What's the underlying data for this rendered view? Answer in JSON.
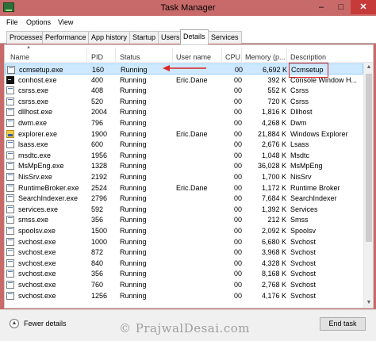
{
  "window": {
    "title": "Task Manager",
    "minimize_glyph": "–",
    "maximize_glyph": "□",
    "close_glyph": "✕"
  },
  "menu": [
    {
      "label": "File"
    },
    {
      "label": "Options"
    },
    {
      "label": "View"
    }
  ],
  "tabs": [
    {
      "label": "Processes"
    },
    {
      "label": "Performance"
    },
    {
      "label": "App history"
    },
    {
      "label": "Startup"
    },
    {
      "label": "Users"
    },
    {
      "label": "Details"
    },
    {
      "label": "Services"
    }
  ],
  "active_tab": "Details",
  "columns": {
    "name": "Name",
    "pid": "PID",
    "status": "Status",
    "user": "User name",
    "cpu": "CPU",
    "memory": "Memory (p...",
    "description": "Description"
  },
  "rows": [
    {
      "icon": "window-icon",
      "name": "ccmsetup.exe",
      "pid": "160",
      "status": "Running",
      "user": "",
      "cpu": "00",
      "memory": "6,692 K",
      "description": "Ccmsetup"
    },
    {
      "icon": "console-icon",
      "name": "conhost.exe",
      "pid": "400",
      "status": "Running",
      "user": "Eric.Dane",
      "cpu": "00",
      "memory": "392 K",
      "description": "Console Window H..."
    },
    {
      "icon": "window-icon",
      "name": "csrss.exe",
      "pid": "408",
      "status": "Running",
      "user": "",
      "cpu": "00",
      "memory": "552 K",
      "description": "Csrss"
    },
    {
      "icon": "window-icon",
      "name": "csrss.exe",
      "pid": "520",
      "status": "Running",
      "user": "",
      "cpu": "00",
      "memory": "720 K",
      "description": "Csrss"
    },
    {
      "icon": "window-icon",
      "name": "dllhost.exe",
      "pid": "2004",
      "status": "Running",
      "user": "",
      "cpu": "00",
      "memory": "1,816 K",
      "description": "Dllhost"
    },
    {
      "icon": "window-icon",
      "name": "dwm.exe",
      "pid": "796",
      "status": "Running",
      "user": "",
      "cpu": "00",
      "memory": "4,268 K",
      "description": "Dwm"
    },
    {
      "icon": "explorer-icon",
      "name": "explorer.exe",
      "pid": "1900",
      "status": "Running",
      "user": "Eric.Dane",
      "cpu": "00",
      "memory": "21,884 K",
      "description": "Windows Explorer"
    },
    {
      "icon": "window-icon",
      "name": "lsass.exe",
      "pid": "600",
      "status": "Running",
      "user": "",
      "cpu": "00",
      "memory": "2,676 K",
      "description": "Lsass"
    },
    {
      "icon": "window-icon",
      "name": "msdtc.exe",
      "pid": "1956",
      "status": "Running",
      "user": "",
      "cpu": "00",
      "memory": "1,048 K",
      "description": "Msdtc"
    },
    {
      "icon": "window-icon",
      "name": "MsMpEng.exe",
      "pid": "1328",
      "status": "Running",
      "user": "",
      "cpu": "00",
      "memory": "36,028 K",
      "description": "MsMpEng"
    },
    {
      "icon": "window-icon",
      "name": "NisSrv.exe",
      "pid": "2192",
      "status": "Running",
      "user": "",
      "cpu": "00",
      "memory": "1,700 K",
      "description": "NisSrv"
    },
    {
      "icon": "window-icon",
      "name": "RuntimeBroker.exe",
      "pid": "2524",
      "status": "Running",
      "user": "Eric.Dane",
      "cpu": "00",
      "memory": "1,172 K",
      "description": "Runtime Broker"
    },
    {
      "icon": "window-icon",
      "name": "SearchIndexer.exe",
      "pid": "2796",
      "status": "Running",
      "user": "",
      "cpu": "00",
      "memory": "7,684 K",
      "description": "SearchIndexer"
    },
    {
      "icon": "window-icon",
      "name": "services.exe",
      "pid": "592",
      "status": "Running",
      "user": "",
      "cpu": "00",
      "memory": "1,392 K",
      "description": "Services"
    },
    {
      "icon": "window-icon",
      "name": "smss.exe",
      "pid": "356",
      "status": "Running",
      "user": "",
      "cpu": "00",
      "memory": "212 K",
      "description": "Smss"
    },
    {
      "icon": "window-icon",
      "name": "spoolsv.exe",
      "pid": "1500",
      "status": "Running",
      "user": "",
      "cpu": "00",
      "memory": "2,092 K",
      "description": "Spoolsv"
    },
    {
      "icon": "window-icon",
      "name": "svchost.exe",
      "pid": "1000",
      "status": "Running",
      "user": "",
      "cpu": "00",
      "memory": "6,680 K",
      "description": "Svchost"
    },
    {
      "icon": "window-icon",
      "name": "svchost.exe",
      "pid": "872",
      "status": "Running",
      "user": "",
      "cpu": "00",
      "memory": "3,968 K",
      "description": "Svchost"
    },
    {
      "icon": "window-icon",
      "name": "svchost.exe",
      "pid": "840",
      "status": "Running",
      "user": "",
      "cpu": "00",
      "memory": "4,328 K",
      "description": "Svchost"
    },
    {
      "icon": "window-icon",
      "name": "svchost.exe",
      "pid": "356",
      "status": "Running",
      "user": "",
      "cpu": "00",
      "memory": "8,168 K",
      "description": "Svchost"
    },
    {
      "icon": "window-icon",
      "name": "svchost.exe",
      "pid": "760",
      "status": "Running",
      "user": "",
      "cpu": "00",
      "memory": "2,768 K",
      "description": "Svchost"
    },
    {
      "icon": "window-icon",
      "name": "svchost.exe",
      "pid": "1256",
      "status": "Running",
      "user": "",
      "cpu": "00",
      "memory": "4,176 K",
      "description": "Svchost"
    }
  ],
  "footer": {
    "fewer_details": "Fewer details",
    "end_task": "End task"
  },
  "watermark": "© PrajwalDesai.com",
  "colors": {
    "accent_highlight": "#d92626",
    "selection": "#cde8ff",
    "titlebar": "#c96a6a"
  }
}
